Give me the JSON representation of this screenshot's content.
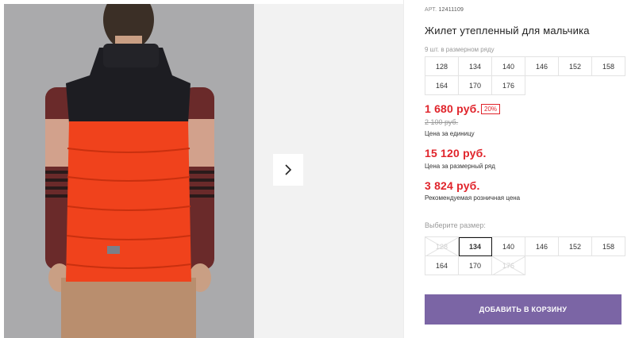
{
  "product": {
    "sku_label": "АРТ.",
    "sku": "12411109",
    "title": "Жилет утепленный для мальчика",
    "size_count": "9 шт. в размерном ряду",
    "size_row": [
      "128",
      "134",
      "140",
      "146",
      "152",
      "158",
      "164",
      "170",
      "176"
    ],
    "price": "1 680 руб.",
    "discount": "20%",
    "old_price": "2 100 руб.",
    "price_unit_caption": "Цена за единицу",
    "price_set": "15 120 руб.",
    "price_set_caption": "Цена за размерный ряд",
    "price_rrp": "3 824 руб.",
    "price_rrp_caption": "Рекомендуемая розничная цена"
  },
  "size_picker": {
    "label": "Выберите размер:",
    "options": [
      {
        "label": "128",
        "state": "disabled"
      },
      {
        "label": "134",
        "state": "selected"
      },
      {
        "label": "140",
        "state": "available"
      },
      {
        "label": "146",
        "state": "available"
      },
      {
        "label": "152",
        "state": "available"
      },
      {
        "label": "158",
        "state": "available"
      },
      {
        "label": "164",
        "state": "available"
      },
      {
        "label": "170",
        "state": "available"
      },
      {
        "label": "176",
        "state": "disabled"
      }
    ]
  },
  "cart": {
    "add_label": "ДОБАВИТЬ В КОРЗИНУ"
  },
  "gallery": {
    "next_icon": "chevron-right-icon"
  },
  "colors": {
    "price": "#e0242b",
    "button": "#7b65a5",
    "vest_orange": "#f0421c",
    "vest_black": "#1d1d22"
  }
}
